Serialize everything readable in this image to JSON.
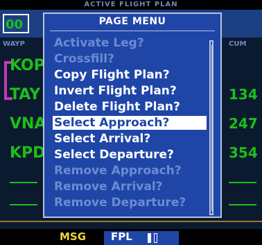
{
  "background": {
    "title": "ACTIVE FLIGHT PLAN",
    "box_value": "00",
    "left_header": "WAYP",
    "right_header": "CUM",
    "waypoints": [
      "KOP",
      "TAY",
      "VNA",
      "KPD"
    ],
    "cum_values": [
      "134",
      "247",
      "354"
    ]
  },
  "menu": {
    "title": "PAGE MENU",
    "items": [
      {
        "label": "Activate Leg?",
        "state": "disabled"
      },
      {
        "label": "Crossfill?",
        "state": "disabled"
      },
      {
        "label": "Copy Flight Plan?",
        "state": "enabled"
      },
      {
        "label": "Invert Flight Plan?",
        "state": "enabled"
      },
      {
        "label": "Delete Flight Plan?",
        "state": "enabled"
      },
      {
        "label": "Select Approach?",
        "state": "selected"
      },
      {
        "label": "Select Arrival?",
        "state": "enabled"
      },
      {
        "label": "Select Departure?",
        "state": "enabled"
      },
      {
        "label": "Remove Approach?",
        "state": "disabled"
      },
      {
        "label": "Remove Arrival?",
        "state": "disabled"
      },
      {
        "label": "Remove Departure?",
        "state": "disabled"
      }
    ]
  },
  "status_bar": {
    "msg": "MSG",
    "fpl": "FPL"
  },
  "colors": {
    "menu_bg": "#1f46a7",
    "enabled_text": "#ffffff",
    "disabled_text": "#6e8bd0",
    "waypoint_green": "#1ac01a",
    "msg_yellow": "#f0d23c"
  }
}
